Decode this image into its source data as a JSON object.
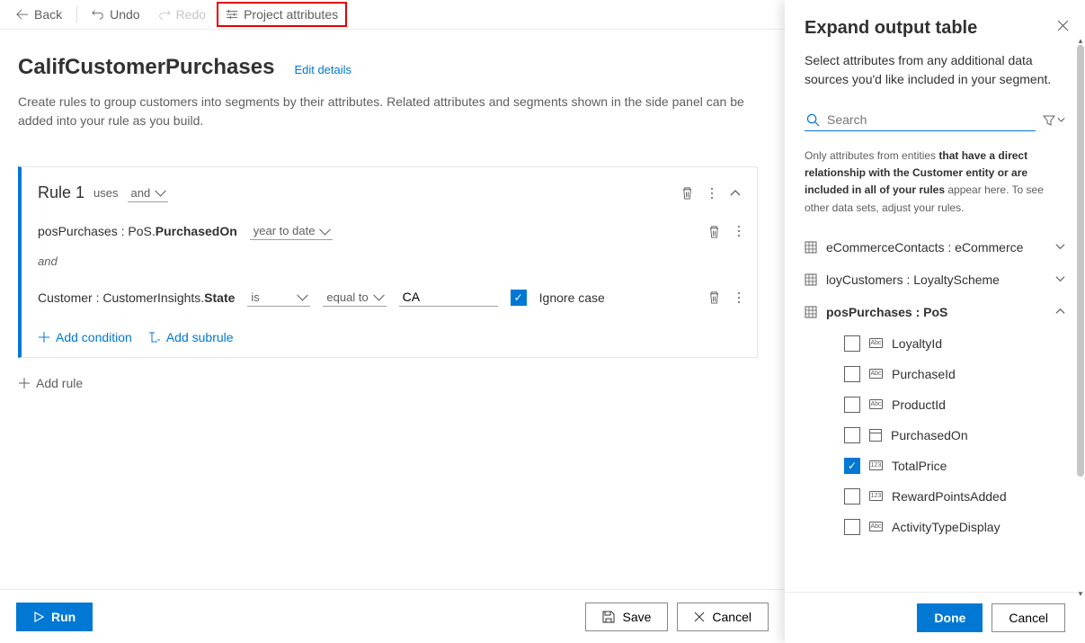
{
  "toolbar": {
    "back": "Back",
    "undo": "Undo",
    "redo": "Redo",
    "project_attributes": "Project attributes"
  },
  "page": {
    "title": "CalifCustomerPurchases",
    "edit_details": "Edit details",
    "description": "Create rules to group customers into segments by their attributes. Related attributes and segments shown in the side panel can be added into your rule as you build."
  },
  "rule": {
    "title": "Rule 1",
    "uses_label": "uses",
    "combiner": "and",
    "cond1_attr_pre": "posPurchases : PoS.",
    "cond1_attr_bold": "PurchasedOn",
    "cond1_op": "year to date",
    "join_text": "and",
    "cond2_attr_pre": "Customer : CustomerInsights.",
    "cond2_attr_bold": "State",
    "cond2_op1": "is",
    "cond2_op2": "equal to",
    "cond2_value": "CA",
    "cond2_ignore_case": "Ignore case",
    "add_condition": "Add condition",
    "add_subrule": "Add subrule"
  },
  "add_rule": "Add rule",
  "footer": {
    "run": "Run",
    "save": "Save",
    "cancel": "Cancel"
  },
  "panel": {
    "title": "Expand output table",
    "description": "Select attributes from any additional data sources you'd like included in your segment.",
    "search_placeholder": "Search",
    "helper_pre": "Only attributes from entities ",
    "helper_bold": "that have a direct relationship with the Customer entity or are included in all of your rules",
    "helper_post": " appear here. To see other data sets, adjust your rules.",
    "entities": [
      {
        "label": "eCommerceContacts : eCommerce",
        "expanded": false
      },
      {
        "label": "loyCustomers : LoyaltyScheme",
        "expanded": false
      },
      {
        "label": "posPurchases : PoS",
        "expanded": true
      }
    ],
    "attributes": [
      {
        "label": "LoyaltyId",
        "checked": false,
        "type": "abc"
      },
      {
        "label": "PurchaseId",
        "checked": false,
        "type": "abc"
      },
      {
        "label": "ProductId",
        "checked": false,
        "type": "abc"
      },
      {
        "label": "PurchasedOn",
        "checked": false,
        "type": "date"
      },
      {
        "label": "TotalPrice",
        "checked": true,
        "type": "num"
      },
      {
        "label": "RewardPointsAdded",
        "checked": false,
        "type": "num"
      },
      {
        "label": "ActivityTypeDisplay",
        "checked": false,
        "type": "abc"
      }
    ],
    "done": "Done",
    "cancel": "Cancel"
  }
}
